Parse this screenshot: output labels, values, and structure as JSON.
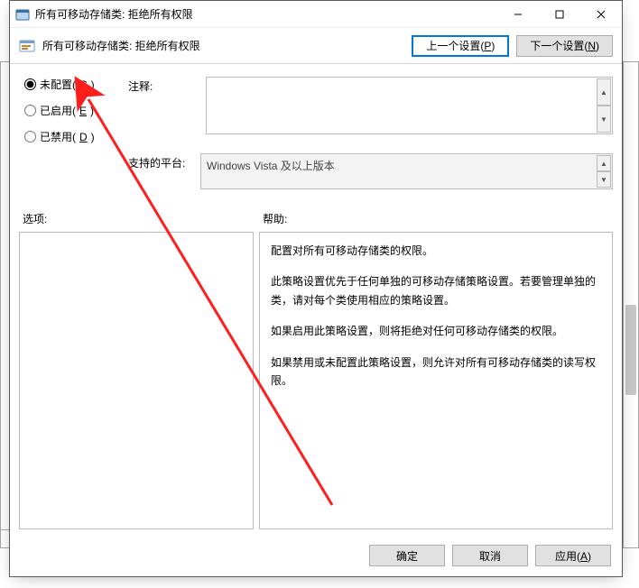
{
  "titlebar": {
    "title": "所有可移动存储类: 拒绝所有权限"
  },
  "header": {
    "policy_title": "所有可移动存储类: 拒绝所有权限",
    "prev_label_a": "上一个设置(",
    "prev_key": "P",
    "prev_label_b": ")",
    "next_label_a": "下一个设置(",
    "next_key": "N",
    "next_label_b": ")"
  },
  "radios": {
    "not_configured_a": "未配置(",
    "not_configured_key": "C",
    "not_configured_b": ")",
    "enabled_a": "已启用(",
    "enabled_key": "E",
    "enabled_b": ")",
    "disabled_a": "已禁用(",
    "disabled_key": "D",
    "disabled_b": ")"
  },
  "labels": {
    "comment": "注释:",
    "supported": "支持的平台:",
    "options": "选项:",
    "help": "帮助:"
  },
  "platform": {
    "text": "Windows Vista 及以上版本"
  },
  "help": {
    "p1": "配置对所有可移动存储类的权限。",
    "p2": "此策略设置优先于任何单独的可移动存储策略设置。若要管理单独的类，请对每个类使用相应的策略设置。",
    "p3": "如果启用此策略设置，则将拒绝对任何可移动存储类的权限。",
    "p4": "如果禁用或未配置此策略设置，则允许对所有可移动存储类的读写权限。"
  },
  "footer": {
    "ok": "确定",
    "cancel": "取消",
    "apply_a": "应用(",
    "apply_key": "A",
    "apply_b": ")"
  }
}
